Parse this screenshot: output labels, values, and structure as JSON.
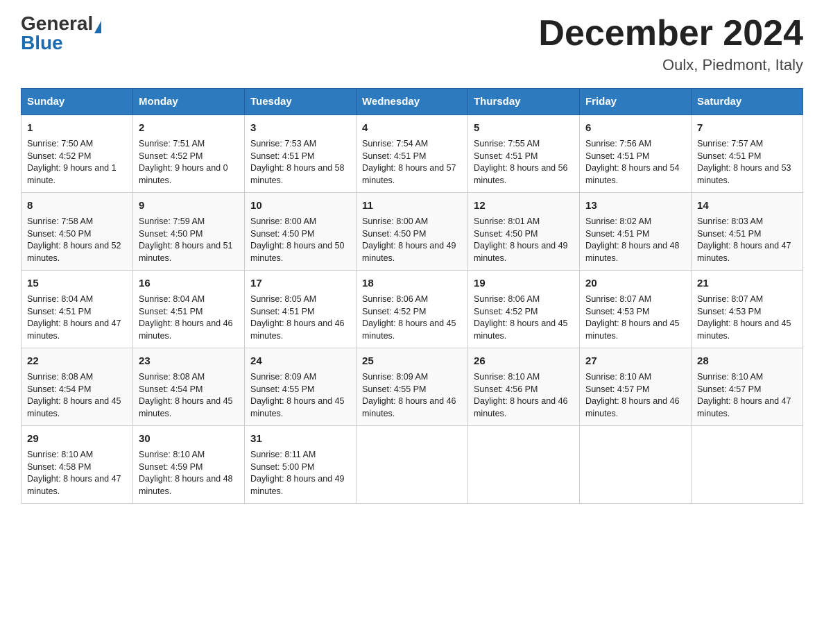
{
  "header": {
    "logo_general": "General",
    "logo_blue": "Blue",
    "month_title": "December 2024",
    "location": "Oulx, Piedmont, Italy"
  },
  "days_of_week": [
    "Sunday",
    "Monday",
    "Tuesday",
    "Wednesday",
    "Thursday",
    "Friday",
    "Saturday"
  ],
  "weeks": [
    [
      {
        "day": "1",
        "sunrise": "7:50 AM",
        "sunset": "4:52 PM",
        "daylight": "9 hours and 1 minute."
      },
      {
        "day": "2",
        "sunrise": "7:51 AM",
        "sunset": "4:52 PM",
        "daylight": "9 hours and 0 minutes."
      },
      {
        "day": "3",
        "sunrise": "7:53 AM",
        "sunset": "4:51 PM",
        "daylight": "8 hours and 58 minutes."
      },
      {
        "day": "4",
        "sunrise": "7:54 AM",
        "sunset": "4:51 PM",
        "daylight": "8 hours and 57 minutes."
      },
      {
        "day": "5",
        "sunrise": "7:55 AM",
        "sunset": "4:51 PM",
        "daylight": "8 hours and 56 minutes."
      },
      {
        "day": "6",
        "sunrise": "7:56 AM",
        "sunset": "4:51 PM",
        "daylight": "8 hours and 54 minutes."
      },
      {
        "day": "7",
        "sunrise": "7:57 AM",
        "sunset": "4:51 PM",
        "daylight": "8 hours and 53 minutes."
      }
    ],
    [
      {
        "day": "8",
        "sunrise": "7:58 AM",
        "sunset": "4:50 PM",
        "daylight": "8 hours and 52 minutes."
      },
      {
        "day": "9",
        "sunrise": "7:59 AM",
        "sunset": "4:50 PM",
        "daylight": "8 hours and 51 minutes."
      },
      {
        "day": "10",
        "sunrise": "8:00 AM",
        "sunset": "4:50 PM",
        "daylight": "8 hours and 50 minutes."
      },
      {
        "day": "11",
        "sunrise": "8:00 AM",
        "sunset": "4:50 PM",
        "daylight": "8 hours and 49 minutes."
      },
      {
        "day": "12",
        "sunrise": "8:01 AM",
        "sunset": "4:50 PM",
        "daylight": "8 hours and 49 minutes."
      },
      {
        "day": "13",
        "sunrise": "8:02 AM",
        "sunset": "4:51 PM",
        "daylight": "8 hours and 48 minutes."
      },
      {
        "day": "14",
        "sunrise": "8:03 AM",
        "sunset": "4:51 PM",
        "daylight": "8 hours and 47 minutes."
      }
    ],
    [
      {
        "day": "15",
        "sunrise": "8:04 AM",
        "sunset": "4:51 PM",
        "daylight": "8 hours and 47 minutes."
      },
      {
        "day": "16",
        "sunrise": "8:04 AM",
        "sunset": "4:51 PM",
        "daylight": "8 hours and 46 minutes."
      },
      {
        "day": "17",
        "sunrise": "8:05 AM",
        "sunset": "4:51 PM",
        "daylight": "8 hours and 46 minutes."
      },
      {
        "day": "18",
        "sunrise": "8:06 AM",
        "sunset": "4:52 PM",
        "daylight": "8 hours and 45 minutes."
      },
      {
        "day": "19",
        "sunrise": "8:06 AM",
        "sunset": "4:52 PM",
        "daylight": "8 hours and 45 minutes."
      },
      {
        "day": "20",
        "sunrise": "8:07 AM",
        "sunset": "4:53 PM",
        "daylight": "8 hours and 45 minutes."
      },
      {
        "day": "21",
        "sunrise": "8:07 AM",
        "sunset": "4:53 PM",
        "daylight": "8 hours and 45 minutes."
      }
    ],
    [
      {
        "day": "22",
        "sunrise": "8:08 AM",
        "sunset": "4:54 PM",
        "daylight": "8 hours and 45 minutes."
      },
      {
        "day": "23",
        "sunrise": "8:08 AM",
        "sunset": "4:54 PM",
        "daylight": "8 hours and 45 minutes."
      },
      {
        "day": "24",
        "sunrise": "8:09 AM",
        "sunset": "4:55 PM",
        "daylight": "8 hours and 45 minutes."
      },
      {
        "day": "25",
        "sunrise": "8:09 AM",
        "sunset": "4:55 PM",
        "daylight": "8 hours and 46 minutes."
      },
      {
        "day": "26",
        "sunrise": "8:10 AM",
        "sunset": "4:56 PM",
        "daylight": "8 hours and 46 minutes."
      },
      {
        "day": "27",
        "sunrise": "8:10 AM",
        "sunset": "4:57 PM",
        "daylight": "8 hours and 46 minutes."
      },
      {
        "day": "28",
        "sunrise": "8:10 AM",
        "sunset": "4:57 PM",
        "daylight": "8 hours and 47 minutes."
      }
    ],
    [
      {
        "day": "29",
        "sunrise": "8:10 AM",
        "sunset": "4:58 PM",
        "daylight": "8 hours and 47 minutes."
      },
      {
        "day": "30",
        "sunrise": "8:10 AM",
        "sunset": "4:59 PM",
        "daylight": "8 hours and 48 minutes."
      },
      {
        "day": "31",
        "sunrise": "8:11 AM",
        "sunset": "5:00 PM",
        "daylight": "8 hours and 49 minutes."
      },
      null,
      null,
      null,
      null
    ]
  ],
  "labels": {
    "sunrise_prefix": "Sunrise: ",
    "sunset_prefix": "Sunset: ",
    "daylight_prefix": "Daylight: "
  }
}
